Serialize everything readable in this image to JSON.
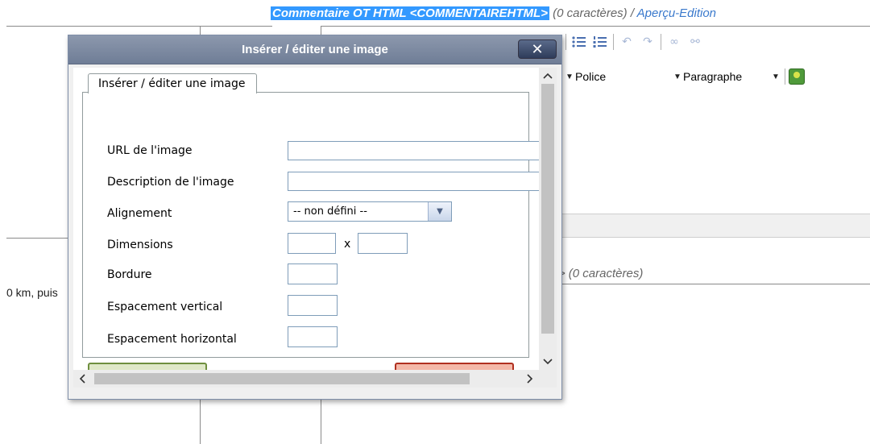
{
  "background": {
    "header": {
      "field_name": "Commentaire OT HTML <COMMENTAIREHTML>",
      "count": "(0 caractères)",
      "separator": "/",
      "link": "Aperçu-Edition"
    },
    "toolbar": {
      "font_combo": "Police",
      "format_combo": "Paragraphe"
    },
    "second_header_fragment": "'> (0 caractères)",
    "left_text_fragment": "0 km, puis"
  },
  "dialog": {
    "title": "Insérer / éditer une image",
    "close_label": "✕",
    "tab_label": "Insérer / éditer une image",
    "fields": {
      "url_label": "URL de l'image",
      "url_value": "",
      "description_label": "Description de l'image",
      "description_value": "",
      "alignment_label": "Alignement",
      "alignment_value": "-- non défini --",
      "dimensions_label": "Dimensions",
      "dimensions_separator": "x",
      "width_value": "",
      "height_value": "",
      "border_label": "Bordure",
      "border_value": "",
      "vspace_label": "Espacement vertical",
      "vspace_value": "",
      "hspace_label": "Espacement horizontal",
      "hspace_value": ""
    }
  },
  "icons": {
    "bullet_list": "bullet-list-icon",
    "numbered_list": "numbered-list-icon",
    "undo": "undo-icon",
    "redo": "redo-icon",
    "link": "link-icon",
    "unlink": "unlink-icon",
    "image": "image-icon"
  },
  "colors": {
    "field_highlight": "#3399ff",
    "link": "#3a79cc",
    "titlebar": "#7b889f",
    "insert_border": "#6f8f3f",
    "cancel_border": "#b03020"
  }
}
